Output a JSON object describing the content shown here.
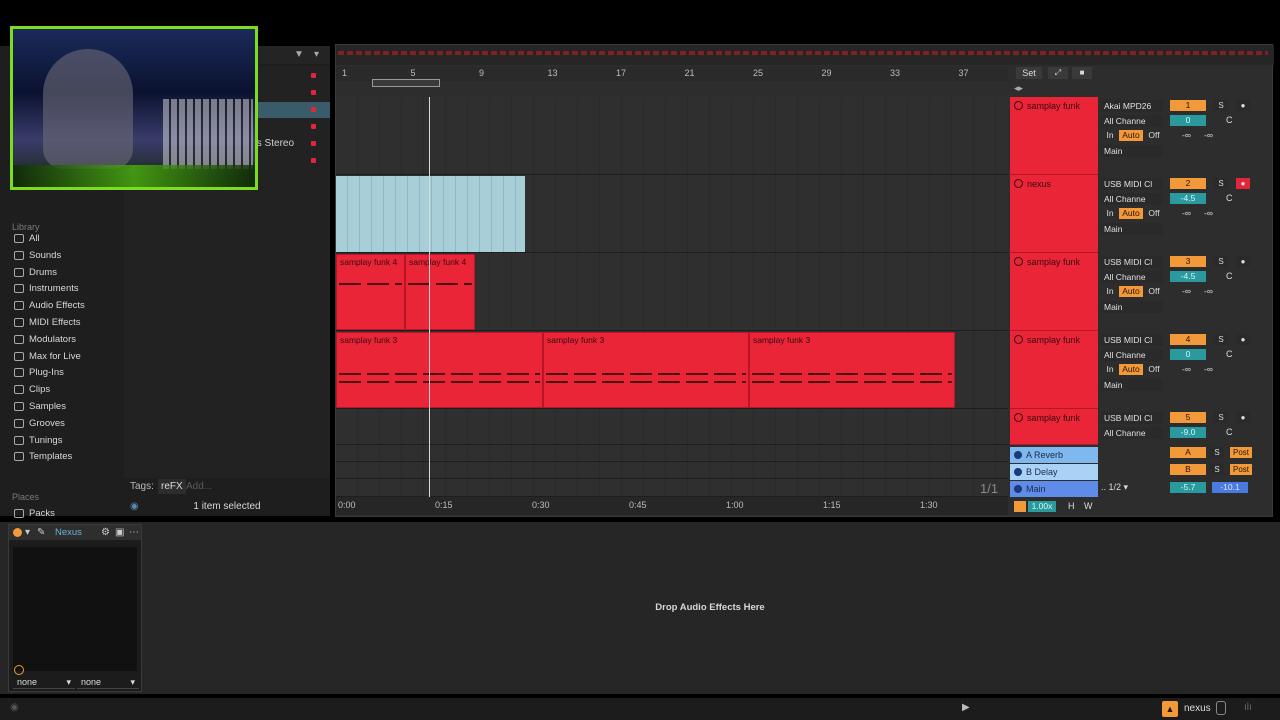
{
  "browser": {
    "library_label": "Library",
    "library_items": [
      "All",
      "Sounds",
      "Drums",
      "Instruments",
      "Audio Effects",
      "MIDI Effects",
      "Modulators",
      "Max for Live",
      "Plug-Ins",
      "Clips",
      "Samples",
      "Grooves",
      "Tunings",
      "Templates"
    ],
    "places_label": "Places",
    "places_items": [
      "Packs"
    ],
    "partial_row_text": "ts Stereo",
    "tags_label": "Tags:",
    "tag": "reFX",
    "add_tag_placeholder": "Add...",
    "status": "1 item selected"
  },
  "arrangement": {
    "bar_numbers": [
      "1",
      "5",
      "9",
      "13",
      "17",
      "21",
      "25",
      "29",
      "33",
      "37"
    ],
    "time_labels": [
      "0:00",
      "0:15",
      "0:30",
      "0:45",
      "1:00",
      "1:15",
      "1:30"
    ],
    "page_indicator": "1/1",
    "set_label": "Set",
    "clips": [
      {
        "name": "samplay funk 4"
      },
      {
        "name": "samplay funk 4"
      },
      {
        "name": "samplay funk 3"
      },
      {
        "name": "samplay funk 3"
      },
      {
        "name": "samplay funk 3"
      }
    ]
  },
  "tracks": [
    {
      "name": "samplay funk",
      "input": "Akai MPD26",
      "channel": "All Channe",
      "number": "1",
      "volume": "0",
      "pan": "C",
      "sends": [
        "-∞",
        "-∞"
      ],
      "output": "Main"
    },
    {
      "name": "nexus",
      "input": "USB MIDI Cl",
      "channel": "All Channe",
      "number": "2",
      "volume": "-4.5",
      "pan": "C",
      "sends": [
        "-∞",
        "-∞"
      ],
      "output": "Main"
    },
    {
      "name": "samplay funk",
      "input": "USB MIDI Cl",
      "channel": "All Channe",
      "number": "3",
      "volume": "-4.5",
      "pan": "C",
      "sends": [
        "-∞",
        "-∞"
      ],
      "output": "Main"
    },
    {
      "name": "samplay funk",
      "input": "USB MIDI Cl",
      "channel": "All Channe",
      "number": "4",
      "volume": "0",
      "pan": "C",
      "sends": [
        "-∞",
        "-∞"
      ],
      "output": "Main"
    },
    {
      "name": "samplay funk",
      "input": "USB MIDI Cl",
      "channel": "All Channe",
      "number": "5",
      "volume": "-9.0",
      "pan": "C"
    }
  ],
  "monitor_labels": {
    "in": "In",
    "auto": "Auto",
    "off": "Off",
    "solo": "S",
    "post": "Post"
  },
  "returns": [
    {
      "name": "A Reverb",
      "letter": "A"
    },
    {
      "name": "B Delay",
      "letter": "B"
    }
  ],
  "main": {
    "name": "Main",
    "tempo_div": "1/2",
    "volume": "-5.7",
    "peak": "-10.1",
    "zoom": "1.00x",
    "h": "H",
    "w": "W"
  },
  "device": {
    "title": "Nexus",
    "dropdown_left": "none",
    "dropdown_right": "none",
    "drop_hint": "Drop Audio Effects Here"
  },
  "statusbar": {
    "track_name": "nexus"
  },
  "colors": {
    "track_red": "#ea2538",
    "clip_blue": "#a8cfd7",
    "accent_orange": "#f29a3a",
    "volume_teal": "#2a9a9e",
    "webcam_border": "#7ddc1f"
  }
}
